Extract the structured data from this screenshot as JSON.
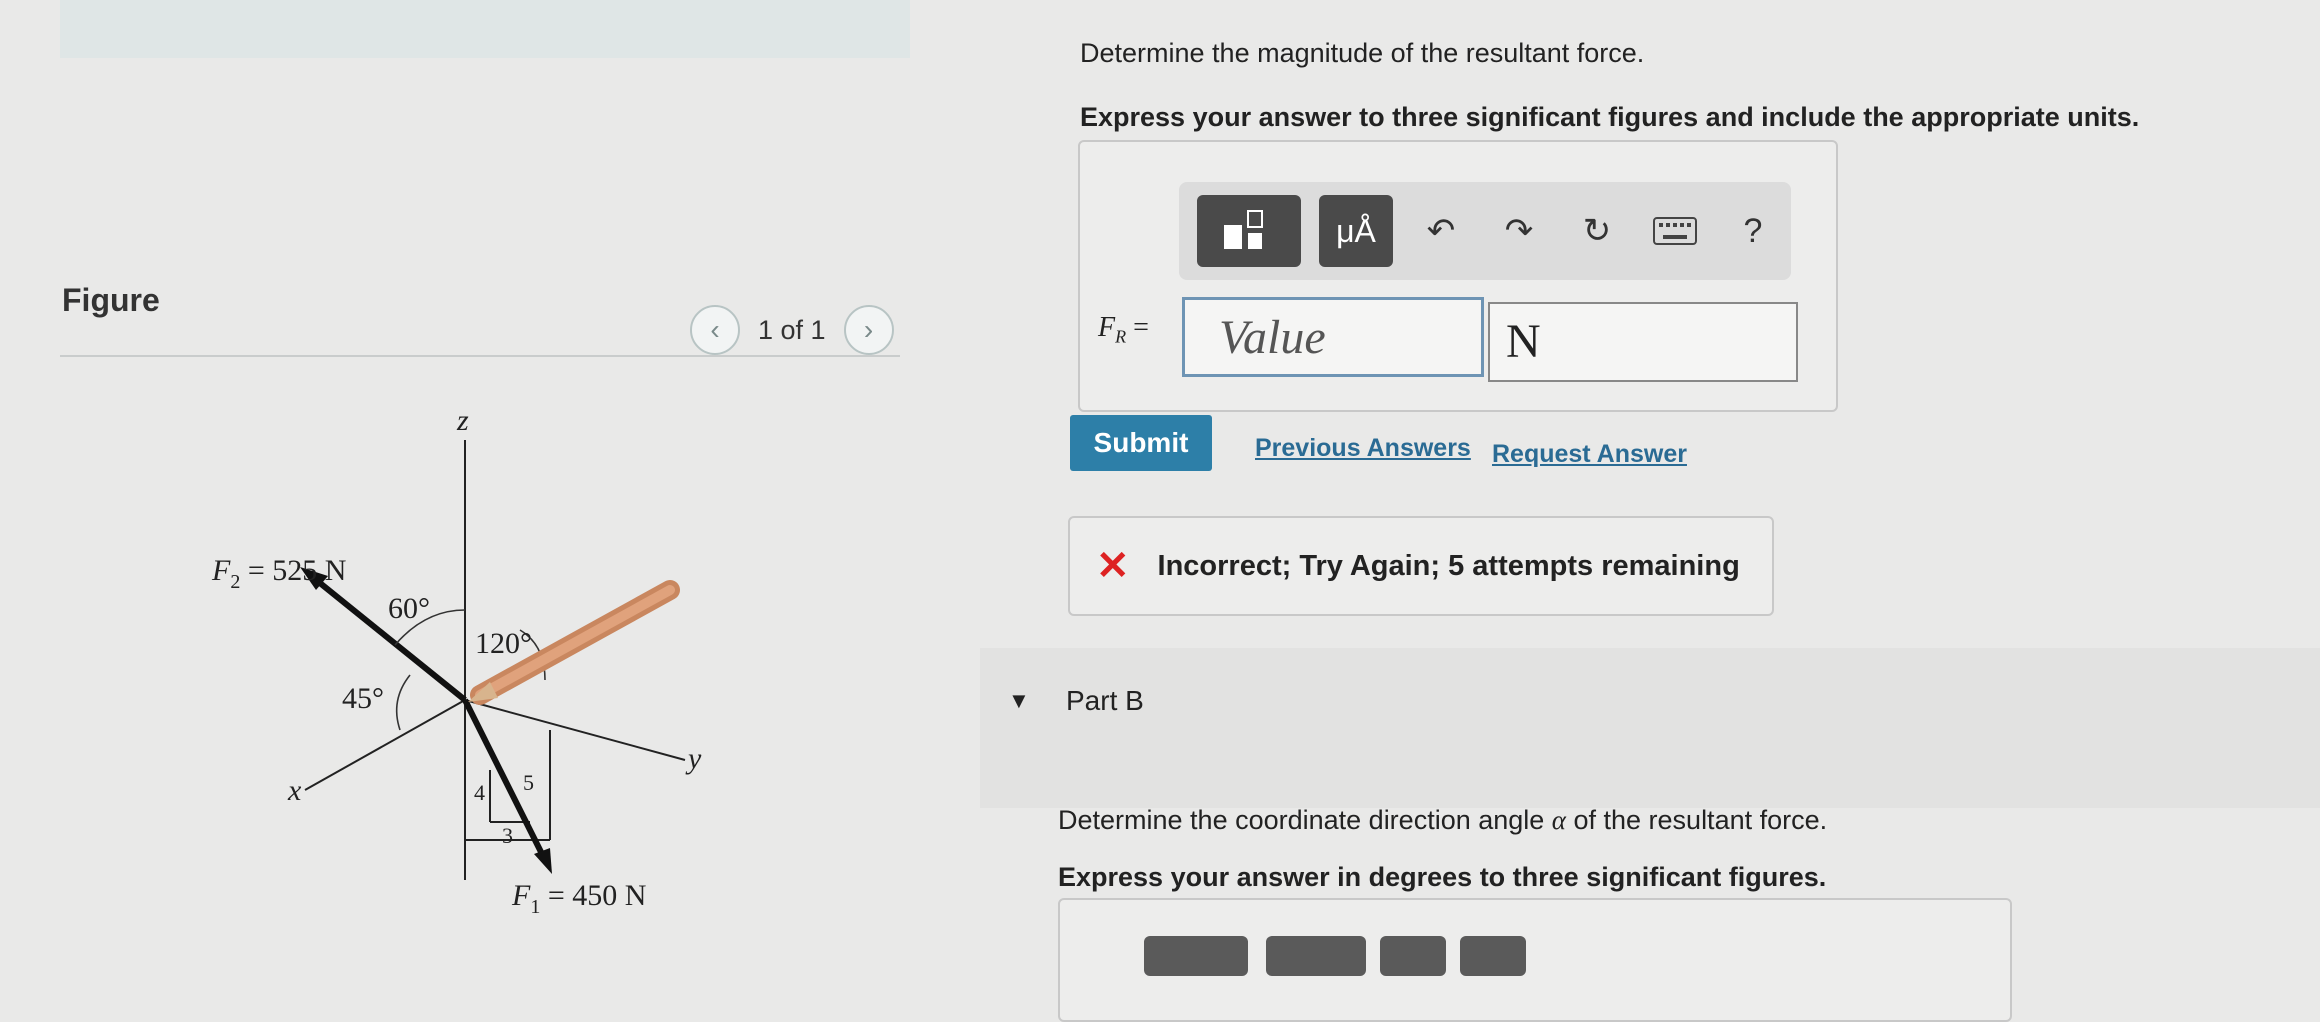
{
  "figure_panel": {
    "label": "Figure",
    "pager": "1 of 1",
    "prev_icon": "chevron-left-icon",
    "next_icon": "chevron-right-icon",
    "diagram": {
      "axis_z": "z",
      "axis_y": "y",
      "axis_x": "x",
      "f2_label": "F",
      "f2_sub": "2",
      "f2_value": " = 525 N",
      "f1_label": "F",
      "f1_sub": "1",
      "f1_value": " = 450 N",
      "angle_60": "60°",
      "angle_120": "120°",
      "angle_45": "45°",
      "tri_4": "4",
      "tri_5": "5",
      "tri_3": "3"
    }
  },
  "part_a": {
    "prompt": "Determine the magnitude of the resultant force.",
    "instruction": "Express your answer to three significant figures and include the appropriate units.",
    "toolbar": {
      "template_icon": "fraction-template-icon",
      "units_label": "μÅ",
      "undo_icon": "undo-icon",
      "redo_icon": "redo-icon",
      "reset_icon": "reset-icon",
      "keyboard_icon": "keyboard-icon",
      "help_label": "?"
    },
    "answer_label": "F",
    "answer_sub": "R",
    "answer_eq": " =",
    "value_placeholder": "Value",
    "unit_value": "N",
    "submit_label": "Submit",
    "previous_answers": "Previous Answers",
    "request_answer": "Request Answer",
    "feedback": "Incorrect; Try Again; 5 attempts remaining"
  },
  "part_b": {
    "title": "Part B",
    "prompt_pre": "Determine the coordinate direction angle ",
    "prompt_symbol": "α",
    "prompt_post": " of the resultant force.",
    "instruction": "Express your answer in degrees to three significant figures."
  },
  "colors": {
    "accent": "#2d7fa8",
    "error": "#dd2222",
    "link": "#2a6b94"
  }
}
